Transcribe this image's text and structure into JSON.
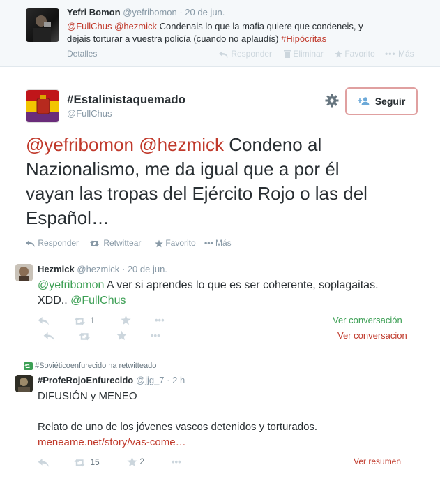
{
  "tweet_top": {
    "name": "Yefri Bomon",
    "handle": "@yefribomon",
    "time": "· 20 de jun.",
    "mention1": "@FullChus",
    "mention2": "@hezmick",
    "text1": " Condenais lo que la mafia quiere que condeneis, y",
    "text2": "dejais torturar a vuestra policía (cuando no aplaudís) ",
    "hashtag": "#Hipócritas",
    "details": "Detalles",
    "actions": [
      "Responder",
      "Eliminar",
      "Favorito",
      "Más"
    ]
  },
  "main_tweet": {
    "name": "#Estalinistaquemado",
    "handle": "@FullChus",
    "follow_label": "Seguir",
    "mention1": "@yefribomon",
    "mention2": "@hezmick",
    "line1_rest": " Condeno al",
    "line2": "Nazionalismo, me da igual que a por él",
    "line3": "vayan las tropas del Ejército Rojo o las del",
    "line4": "Español…",
    "actions": [
      "Responder",
      "Retwittear",
      "Favorito",
      "Más"
    ]
  },
  "reply": {
    "name": "Hezmick",
    "handle": "@hezmick",
    "time": "· 20 de jun.",
    "mention1": "@yefribomon",
    "text1": " A ver si aprendes lo que es ser coherente, soplagaitas.",
    "text2": "XDD.. ",
    "mention2": "@FullChus",
    "retweet_count": "1",
    "view_conversation_1": "Ver conversación",
    "view_conversation_2": "Ver conversacion"
  },
  "retweet": {
    "context": "#Soviéticoenfurecido ha retwitteado",
    "name": "#ProfeRojoEnfurecido",
    "handle": "@jjg_7",
    "time": "· 2 h",
    "line1": "DIFUSIÓN y MENEO",
    "line2": "Relato de uno de los jóvenes vascos detenidos y torturados.",
    "link": "meneame.net/story/vas-come…",
    "retweet_count": "15",
    "favorite_count": "2",
    "summary": "Ver resumen"
  },
  "colors": {
    "link_red": "#c0392b",
    "link_green": "#3c9f54",
    "muted": "#8899a6",
    "top_bg": "#f5f8fa",
    "follow_border": "#e0a0a0"
  }
}
